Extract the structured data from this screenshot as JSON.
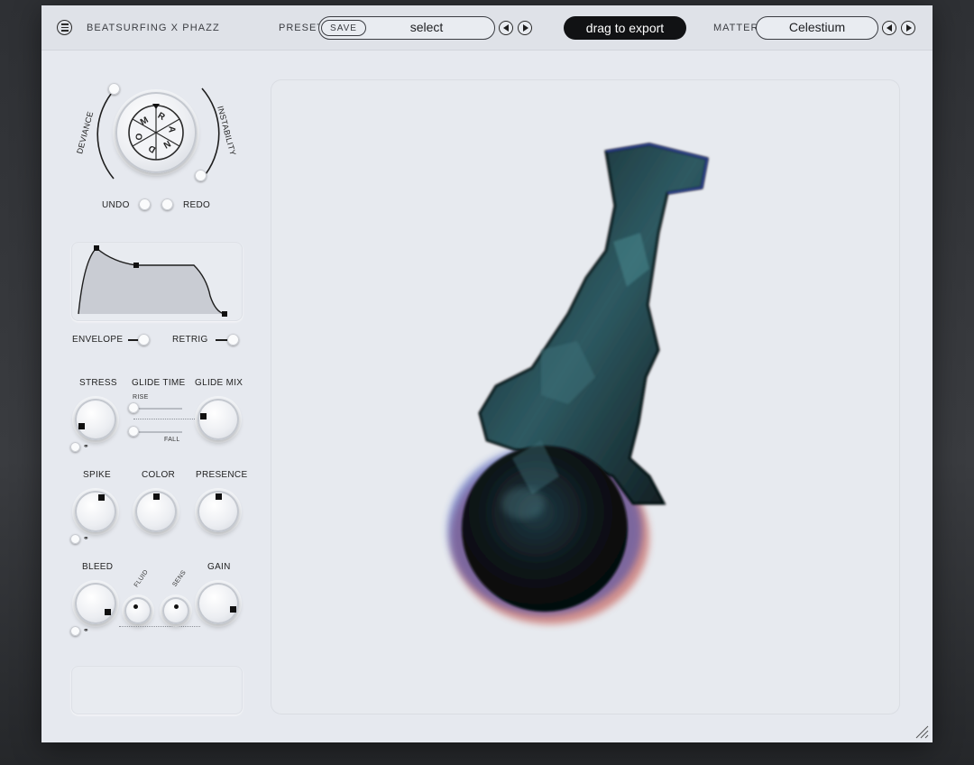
{
  "header": {
    "brand": "BEATSURFING X PHAZZ",
    "preset_label": "PRESET",
    "save_label": "SAVE",
    "preset_value": "select",
    "export_label": "drag to export",
    "matter_label": "MATTER",
    "matter_value": "Celestium"
  },
  "random": {
    "deviance_label": "DEVIANCE",
    "instability_label": "INSTABILITY",
    "dial_letters": [
      "R",
      "A",
      "N",
      "D",
      "O",
      "M"
    ],
    "undo_label": "UNDO",
    "redo_label": "REDO"
  },
  "envelope": {
    "label": "ENVELOPE",
    "retrig_label": "RETRIG"
  },
  "controls": {
    "stress": "STRESS",
    "glide_time": "GLIDE TIME",
    "glide_mix": "GLIDE MIX",
    "rise": "RISE",
    "fall": "FALL",
    "spike": "SPIKE",
    "color": "COLOR",
    "presence": "PRESENCE",
    "bleed": "BLEED",
    "fluid": "FLUID",
    "sens": "SENS",
    "gain": "GAIN"
  },
  "colors": {
    "panel": "#e6e9ef",
    "accent": "#111214",
    "knob_indicator": "#111111"
  }
}
